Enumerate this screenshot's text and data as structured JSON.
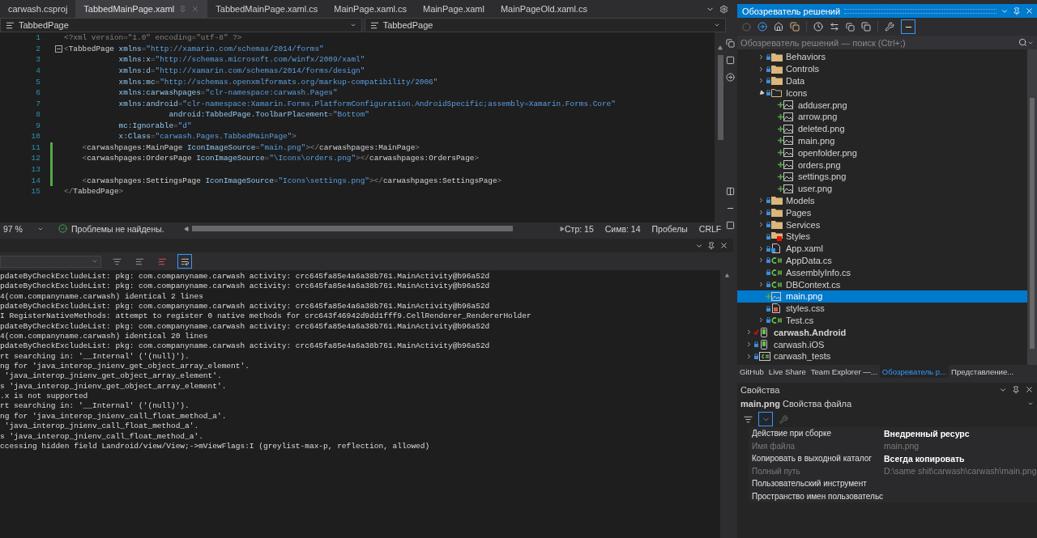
{
  "editor_tabs": [
    {
      "label": "carwash.csproj",
      "selected": false
    },
    {
      "label": "TabbedMainPage.xaml",
      "selected": true
    },
    {
      "label": "TabbedMainPage.xaml.cs",
      "selected": false
    },
    {
      "label": "MainPage.xaml.cs",
      "selected": false
    },
    {
      "label": "MainPage.xaml",
      "selected": false
    },
    {
      "label": "MainPageOld.xaml.cs",
      "selected": false
    }
  ],
  "nav": {
    "left": "TabbedPage",
    "right": "TabbedPage"
  },
  "code_lines": [
    {
      "number": "1",
      "changed": false,
      "fold": false,
      "tokens": [
        {
          "kind": "punct",
          "text": "<?xml version=\"1.0\" encoding=\"utf-8\" ?>"
        }
      ]
    },
    {
      "number": "2",
      "changed": false,
      "fold": true,
      "tokens": [
        {
          "kind": "punct",
          "text": "<"
        },
        {
          "kind": "tag",
          "text": "TabbedPage "
        },
        {
          "kind": "attr",
          "text": "xmlns"
        },
        {
          "kind": "punct",
          "text": "="
        },
        {
          "kind": "value",
          "text": "\"http://xamarin.com/schemas/2014/forms\""
        }
      ]
    },
    {
      "number": "3",
      "changed": false,
      "fold": false,
      "tokens": [
        {
          "kind": "attr",
          "text": "            xmlns:x"
        },
        {
          "kind": "punct",
          "text": "="
        },
        {
          "kind": "value",
          "text": "\"http://schemas.microsoft.com/winfx/2009/xaml\""
        }
      ]
    },
    {
      "number": "4",
      "changed": false,
      "fold": false,
      "tokens": [
        {
          "kind": "attr",
          "text": "            xmlns:d"
        },
        {
          "kind": "punct",
          "text": "="
        },
        {
          "kind": "value",
          "text": "\"http://xamarin.com/schemas/2014/forms/design\""
        }
      ]
    },
    {
      "number": "5",
      "changed": false,
      "fold": false,
      "tokens": [
        {
          "kind": "attr",
          "text": "            xmlns:mc"
        },
        {
          "kind": "punct",
          "text": "="
        },
        {
          "kind": "value",
          "text": "\"http://schemas.openxmlformats.org/markup-compatibility/2006\""
        }
      ]
    },
    {
      "number": "6",
      "changed": false,
      "fold": false,
      "tokens": [
        {
          "kind": "attr",
          "text": "            xmlns:carwashpages"
        },
        {
          "kind": "punct",
          "text": "="
        },
        {
          "kind": "value",
          "text": "\"clr-namespace:carwash.Pages\""
        }
      ]
    },
    {
      "number": "7",
      "changed": false,
      "fold": false,
      "tokens": [
        {
          "kind": "attr",
          "text": "            xmlns:android"
        },
        {
          "kind": "punct",
          "text": "="
        },
        {
          "kind": "value",
          "text": "\"clr-namespace:Xamarin.Forms.PlatformConfiguration.AndroidSpecific;assembly=Xamarin.Forms.Core\""
        }
      ]
    },
    {
      "number": "8",
      "changed": false,
      "fold": false,
      "tokens": [
        {
          "kind": "attr",
          "text": "                       android:TabbedPage.ToolbarPlacement"
        },
        {
          "kind": "punct",
          "text": "="
        },
        {
          "kind": "value",
          "text": "\"Bottom\""
        }
      ]
    },
    {
      "number": "9",
      "changed": false,
      "fold": false,
      "tokens": [
        {
          "kind": "attr",
          "text": "            mc:Ignorable"
        },
        {
          "kind": "punct",
          "text": "="
        },
        {
          "kind": "value",
          "text": "\"d\""
        }
      ]
    },
    {
      "number": "10",
      "changed": false,
      "fold": false,
      "tokens": [
        {
          "kind": "attr",
          "text": "            x:Class"
        },
        {
          "kind": "punct",
          "text": "="
        },
        {
          "kind": "value",
          "text": "\"carwash.Pages.TabbedMainPage\""
        },
        {
          "kind": "punct",
          "text": ">"
        }
      ]
    },
    {
      "number": "11",
      "changed": true,
      "fold": false,
      "tokens": [
        {
          "kind": "punct",
          "text": "    <"
        },
        {
          "kind": "tag",
          "text": "carwashpages:MainPage "
        },
        {
          "kind": "attr",
          "text": "IconImageSource"
        },
        {
          "kind": "punct",
          "text": "="
        },
        {
          "kind": "value",
          "text": "\"main.png\""
        },
        {
          "kind": "punct",
          "text": "></"
        },
        {
          "kind": "tag",
          "text": "carwashpages:MainPage"
        },
        {
          "kind": "punct",
          "text": ">"
        }
      ]
    },
    {
      "number": "12",
      "changed": true,
      "fold": false,
      "tokens": [
        {
          "kind": "punct",
          "text": "    <"
        },
        {
          "kind": "tag",
          "text": "carwashpages:OrdersPage "
        },
        {
          "kind": "attr",
          "text": "IconImageSource"
        },
        {
          "kind": "punct",
          "text": "="
        },
        {
          "kind": "value",
          "text": "\"\\Icons\\orders.png\""
        },
        {
          "kind": "punct",
          "text": "></"
        },
        {
          "kind": "tag",
          "text": "carwashpages:OrdersPage"
        },
        {
          "kind": "punct",
          "text": ">"
        }
      ]
    },
    {
      "number": "13",
      "changed": true,
      "fold": false
    },
    {
      "number": "14",
      "changed": true,
      "fold": false,
      "tokens": [
        {
          "kind": "punct",
          "text": "    <"
        },
        {
          "kind": "tag",
          "text": "carwashpages:SettingsPage "
        },
        {
          "kind": "attr",
          "text": "IconImageSource"
        },
        {
          "kind": "punct",
          "text": "="
        },
        {
          "kind": "value",
          "text": "\"Icons\\settings.png\""
        },
        {
          "kind": "punct",
          "text": "></"
        },
        {
          "kind": "tag",
          "text": "carwashpages:SettingsPage"
        },
        {
          "kind": "punct",
          "text": ">"
        }
      ]
    },
    {
      "number": "15",
      "changed": false,
      "fold": false,
      "tokens": [
        {
          "kind": "punct",
          "text": "</"
        },
        {
          "kind": "tag",
          "text": "TabbedPage"
        },
        {
          "kind": "punct",
          "text": ">"
        }
      ]
    }
  ],
  "status": {
    "zoom": "97 %",
    "issues": "Проблемы не найдены.",
    "line": "Стр: 15",
    "column": "Симв: 14",
    "whitespace": "Пробелы",
    "line_ending": "CRLF"
  },
  "output": {
    "lines": [
      "pdateByCheckExcludeList: pkg: com.companyname.carwash activity: crc645fa85e4a6a38b761.MainActivity@b96a52d",
      "pdateByCheckExcludeList: pkg: com.companyname.carwash activity: crc645fa85e4a6a38b761.MainActivity@b96a52d",
      "4(com.companyname.carwash) identical 2 lines",
      "pdateByCheckExcludeList: pkg: com.companyname.carwash activity: crc645fa85e4a6a38b761.MainActivity@b96a52d",
      "I RegisterNativeMethods: attempt to register 0 native methods for crc643f46942d9dd1fff9.CellRenderer_RendererHolder",
      "pdateByCheckExcludeList: pkg: com.companyname.carwash activity: crc645fa85e4a6a38b761.MainActivity@b96a52d",
      "4(com.companyname.carwash) identical 20 lines",
      "pdateByCheckExcludeList: pkg: com.companyname.carwash activity: crc645fa85e4a6a38b761.MainActivity@b96a52d",
      "rt searching in: '__Internal' ('(null)').",
      "ng for 'java_interop_jnienv_get_object_array_element'.",
      " 'java_interop_jnienv_get_object_array_element'.",
      "s 'java_interop_jnienv_get_object_array_element'.",
      ".x is not supported",
      "rt searching in: '__Internal' ('(null)').",
      "ng for 'java_interop_jnienv_call_float_method_a'.",
      " 'java_interop_jnienv_call_float_method_a'.",
      "s 'java_interop_jnienv_call_float_method_a'.",
      "ccessing hidden field Landroid/view/View;->mViewFlags:I (greylist-max-p, reflection, allowed)"
    ]
  },
  "solution_explorer": {
    "title": "Обозреватель решений",
    "search": {
      "placeholder": "Обозреватель решений — поиск (Ctrl+;)"
    },
    "project_items": [
      {
        "label": "Behaviors",
        "kind": "folder",
        "added": false,
        "expanded": false,
        "selected": false
      },
      {
        "label": "Controls",
        "kind": "folder",
        "added": false,
        "expanded": false,
        "selected": false
      },
      {
        "label": "Data",
        "kind": "folder",
        "added": false,
        "expanded": false,
        "selected": false
      },
      {
        "label": "Icons",
        "kind": "folder",
        "added": false,
        "expanded": true,
        "selected": false,
        "children": [
          {
            "label": "adduser.png",
            "kind": "image",
            "added": true,
            "selected": false
          },
          {
            "label": "arrow.png",
            "kind": "image",
            "added": true,
            "selected": false
          },
          {
            "label": "deleted.png",
            "kind": "image",
            "added": true,
            "selected": false
          },
          {
            "label": "main.png",
            "kind": "image",
            "added": true,
            "selected": false
          },
          {
            "label": "openfolder.png",
            "kind": "image",
            "added": true,
            "selected": false
          },
          {
            "label": "orders.png",
            "kind": "image",
            "added": true,
            "selected": false
          },
          {
            "label": "settings.png",
            "kind": "image",
            "added": true,
            "selected": false
          },
          {
            "label": "user.png",
            "kind": "image",
            "added": true,
            "selected": false
          }
        ]
      },
      {
        "label": "Models",
        "kind": "folder",
        "added": false,
        "expanded": false,
        "selected": false
      },
      {
        "label": "Pages",
        "kind": "folder",
        "added": false,
        "expanded": false,
        "selected": false
      },
      {
        "label": "Services",
        "kind": "folder",
        "added": false,
        "expanded": false,
        "selected": false
      },
      {
        "label": "Styles",
        "kind": "excluded-folder",
        "added": false,
        "selected": false
      },
      {
        "label": "App.xaml",
        "kind": "xaml",
        "added": false,
        "expanded": false,
        "selected": false
      },
      {
        "label": "AppData.cs",
        "kind": "csharp",
        "added": false,
        "expanded": false,
        "selected": false
      },
      {
        "label": "AssemblyInfo.cs",
        "kind": "csharp",
        "added": false,
        "selected": false
      },
      {
        "label": "DBContext.cs",
        "kind": "csharp",
        "added": false,
        "expanded": false,
        "selected": false
      },
      {
        "label": "main.png",
        "kind": "image",
        "added": true,
        "selected": true
      },
      {
        "label": "styles.css",
        "kind": "css",
        "added": false,
        "selected": false
      },
      {
        "label": "Test.cs",
        "kind": "csharp",
        "added": false,
        "expanded": false,
        "selected": false
      }
    ],
    "projects": [
      {
        "label": "carwash.Android",
        "kind": "device",
        "added": false,
        "checked_out": true,
        "expanded": false,
        "bold": true,
        "selected": false
      },
      {
        "label": "carwash.iOS",
        "kind": "device",
        "added": false,
        "checked_out": false,
        "expanded": false,
        "bold": false,
        "selected": false
      },
      {
        "label": "carwash_tests",
        "kind": "test",
        "added": false,
        "checked_out": false,
        "expanded": false,
        "bold": false,
        "selected": false
      }
    ]
  },
  "panel_tabs": [
    {
      "label": "GitHub",
      "selected": false
    },
    {
      "label": "Live Share",
      "selected": false
    },
    {
      "label": "Team Explorer —...",
      "selected": false
    },
    {
      "label": "Обозреватель р...",
      "selected": true
    },
    {
      "label": "Представление...",
      "selected": false
    }
  ],
  "properties": {
    "title": "Свойства",
    "object": "main.png",
    "object_type": "Свойства файла",
    "rows": [
      {
        "name": "Действие при сборке",
        "value": "Внедренный ресурс",
        "disabled": false
      },
      {
        "name": "Имя файла",
        "value": "main.png",
        "disabled": true
      },
      {
        "name": "Копировать в выходной каталог",
        "value": "Всегда копировать",
        "disabled": false
      },
      {
        "name": "Полный путь",
        "value": "D:\\same shit\\carwash\\carwash\\main.png",
        "disabled": true
      },
      {
        "name": "Пользовательский инструмент",
        "disabled": false
      },
      {
        "name": "Пространство имен пользовательс",
        "disabled": false
      }
    ]
  }
}
